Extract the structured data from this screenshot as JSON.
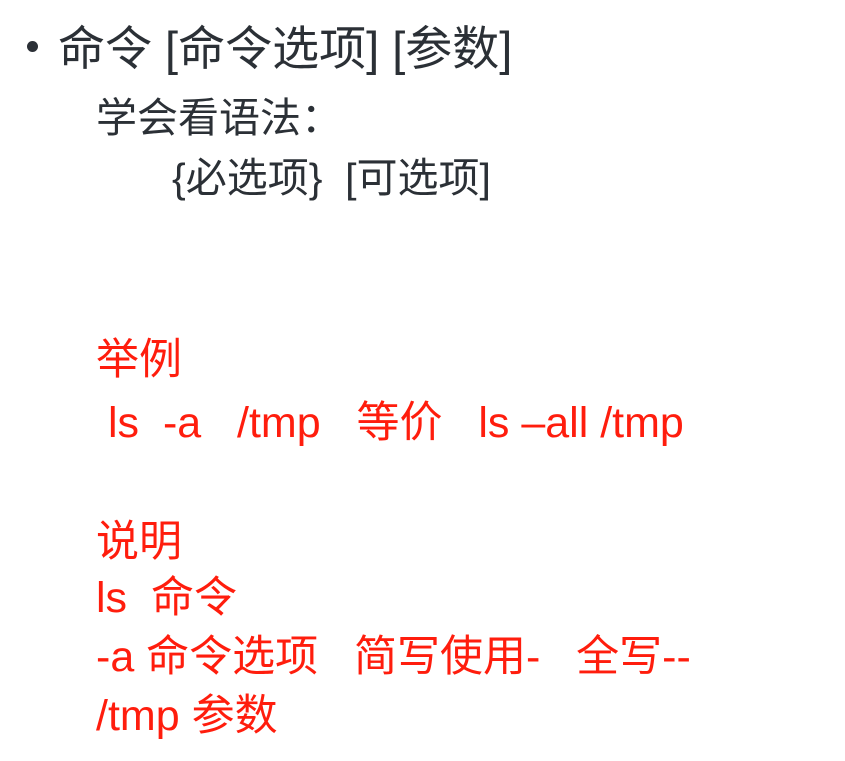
{
  "outline": {
    "title": "命令 [命令选项] [参数]",
    "learn_syntax": "学会看语法：",
    "syntax_forms": "{必选项}  [可选项]"
  },
  "example": {
    "heading": "举例",
    "line": "ls  -a   /tmp   等价   ls –all /tmp"
  },
  "explanation": {
    "heading": "说明",
    "lines": [
      "ls  命令",
      "-a 命令选项   简写使用-   全写--",
      "/tmp 参数"
    ]
  },
  "colors": {
    "text_dark": "#2b3036",
    "text_red": "#ff1d0d",
    "background": "#ffffff"
  }
}
